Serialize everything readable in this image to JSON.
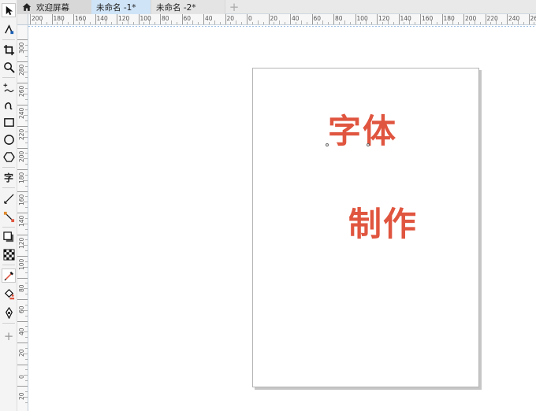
{
  "tabs": [
    {
      "label": "欢迎屏幕",
      "icon": "home-icon"
    },
    {
      "label": "未命名 -1*",
      "active": true
    },
    {
      "label": "未命名 -2*"
    }
  ],
  "tab_add_label": "+",
  "toolbox": {
    "text_tool_glyph": "字",
    "add_tool_glyph": "+",
    "tools": [
      "pick-tool-icon",
      "node-edit-icon",
      "crop-icon",
      "zoom-icon",
      "freehand-icon",
      "artistic-media-icon",
      "rectangle-icon",
      "ellipse-icon",
      "polygon-icon",
      "text-icon",
      "parallel-dimension-icon",
      "connector-icon",
      "drop-shadow-icon",
      "transparency-icon",
      "eyedropper-icon",
      "interactive-fill-icon",
      "smart-fill-icon",
      "add-tool-icon"
    ]
  },
  "ruler_top": [
    "200",
    "180",
    "160",
    "140",
    "120",
    "100",
    "80",
    "60",
    "40",
    "20",
    "0",
    "20",
    "40",
    "60",
    "80",
    "100",
    "120",
    "140",
    "160",
    "180",
    "200",
    "220",
    "240",
    "26"
  ],
  "ruler_left": [
    "300",
    "280",
    "260",
    "240",
    "220",
    "200",
    "180",
    "160",
    "140",
    "120",
    "100",
    "80",
    "60",
    "40",
    "20",
    "0",
    "20"
  ],
  "canvas_text": {
    "line1": "字体",
    "line2": "制作"
  },
  "colors": {
    "art_text": "#e0553f",
    "active_tab": "#cfe4f7"
  }
}
